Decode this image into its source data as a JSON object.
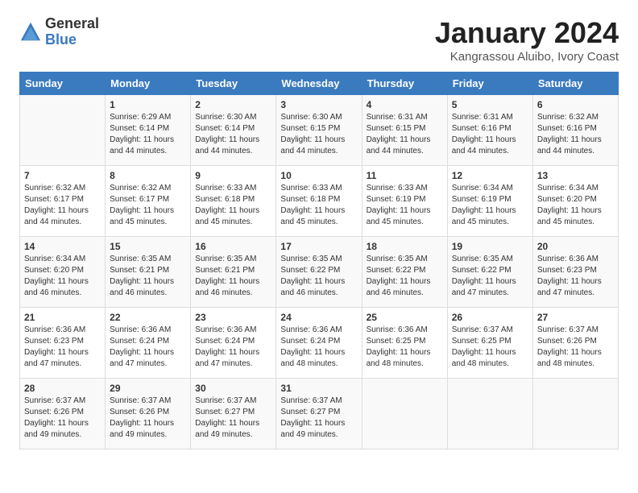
{
  "logo": {
    "general": "General",
    "blue": "Blue"
  },
  "title": {
    "month": "January 2024",
    "location": "Kangrassou Aluibo, Ivory Coast"
  },
  "days_of_week": [
    "Sunday",
    "Monday",
    "Tuesday",
    "Wednesday",
    "Thursday",
    "Friday",
    "Saturday"
  ],
  "weeks": [
    [
      {
        "day": "",
        "sunrise": "",
        "sunset": "",
        "daylight": ""
      },
      {
        "day": "1",
        "sunrise": "Sunrise: 6:29 AM",
        "sunset": "Sunset: 6:14 PM",
        "daylight": "Daylight: 11 hours and 44 minutes."
      },
      {
        "day": "2",
        "sunrise": "Sunrise: 6:30 AM",
        "sunset": "Sunset: 6:14 PM",
        "daylight": "Daylight: 11 hours and 44 minutes."
      },
      {
        "day": "3",
        "sunrise": "Sunrise: 6:30 AM",
        "sunset": "Sunset: 6:15 PM",
        "daylight": "Daylight: 11 hours and 44 minutes."
      },
      {
        "day": "4",
        "sunrise": "Sunrise: 6:31 AM",
        "sunset": "Sunset: 6:15 PM",
        "daylight": "Daylight: 11 hours and 44 minutes."
      },
      {
        "day": "5",
        "sunrise": "Sunrise: 6:31 AM",
        "sunset": "Sunset: 6:16 PM",
        "daylight": "Daylight: 11 hours and 44 minutes."
      },
      {
        "day": "6",
        "sunrise": "Sunrise: 6:32 AM",
        "sunset": "Sunset: 6:16 PM",
        "daylight": "Daylight: 11 hours and 44 minutes."
      }
    ],
    [
      {
        "day": "7",
        "sunrise": "Sunrise: 6:32 AM",
        "sunset": "Sunset: 6:17 PM",
        "daylight": "Daylight: 11 hours and 44 minutes."
      },
      {
        "day": "8",
        "sunrise": "Sunrise: 6:32 AM",
        "sunset": "Sunset: 6:17 PM",
        "daylight": "Daylight: 11 hours and 45 minutes."
      },
      {
        "day": "9",
        "sunrise": "Sunrise: 6:33 AM",
        "sunset": "Sunset: 6:18 PM",
        "daylight": "Daylight: 11 hours and 45 minutes."
      },
      {
        "day": "10",
        "sunrise": "Sunrise: 6:33 AM",
        "sunset": "Sunset: 6:18 PM",
        "daylight": "Daylight: 11 hours and 45 minutes."
      },
      {
        "day": "11",
        "sunrise": "Sunrise: 6:33 AM",
        "sunset": "Sunset: 6:19 PM",
        "daylight": "Daylight: 11 hours and 45 minutes."
      },
      {
        "day": "12",
        "sunrise": "Sunrise: 6:34 AM",
        "sunset": "Sunset: 6:19 PM",
        "daylight": "Daylight: 11 hours and 45 minutes."
      },
      {
        "day": "13",
        "sunrise": "Sunrise: 6:34 AM",
        "sunset": "Sunset: 6:20 PM",
        "daylight": "Daylight: 11 hours and 45 minutes."
      }
    ],
    [
      {
        "day": "14",
        "sunrise": "Sunrise: 6:34 AM",
        "sunset": "Sunset: 6:20 PM",
        "daylight": "Daylight: 11 hours and 46 minutes."
      },
      {
        "day": "15",
        "sunrise": "Sunrise: 6:35 AM",
        "sunset": "Sunset: 6:21 PM",
        "daylight": "Daylight: 11 hours and 46 minutes."
      },
      {
        "day": "16",
        "sunrise": "Sunrise: 6:35 AM",
        "sunset": "Sunset: 6:21 PM",
        "daylight": "Daylight: 11 hours and 46 minutes."
      },
      {
        "day": "17",
        "sunrise": "Sunrise: 6:35 AM",
        "sunset": "Sunset: 6:22 PM",
        "daylight": "Daylight: 11 hours and 46 minutes."
      },
      {
        "day": "18",
        "sunrise": "Sunrise: 6:35 AM",
        "sunset": "Sunset: 6:22 PM",
        "daylight": "Daylight: 11 hours and 46 minutes."
      },
      {
        "day": "19",
        "sunrise": "Sunrise: 6:35 AM",
        "sunset": "Sunset: 6:22 PM",
        "daylight": "Daylight: 11 hours and 47 minutes."
      },
      {
        "day": "20",
        "sunrise": "Sunrise: 6:36 AM",
        "sunset": "Sunset: 6:23 PM",
        "daylight": "Daylight: 11 hours and 47 minutes."
      }
    ],
    [
      {
        "day": "21",
        "sunrise": "Sunrise: 6:36 AM",
        "sunset": "Sunset: 6:23 PM",
        "daylight": "Daylight: 11 hours and 47 minutes."
      },
      {
        "day": "22",
        "sunrise": "Sunrise: 6:36 AM",
        "sunset": "Sunset: 6:24 PM",
        "daylight": "Daylight: 11 hours and 47 minutes."
      },
      {
        "day": "23",
        "sunrise": "Sunrise: 6:36 AM",
        "sunset": "Sunset: 6:24 PM",
        "daylight": "Daylight: 11 hours and 47 minutes."
      },
      {
        "day": "24",
        "sunrise": "Sunrise: 6:36 AM",
        "sunset": "Sunset: 6:24 PM",
        "daylight": "Daylight: 11 hours and 48 minutes."
      },
      {
        "day": "25",
        "sunrise": "Sunrise: 6:36 AM",
        "sunset": "Sunset: 6:25 PM",
        "daylight": "Daylight: 11 hours and 48 minutes."
      },
      {
        "day": "26",
        "sunrise": "Sunrise: 6:37 AM",
        "sunset": "Sunset: 6:25 PM",
        "daylight": "Daylight: 11 hours and 48 minutes."
      },
      {
        "day": "27",
        "sunrise": "Sunrise: 6:37 AM",
        "sunset": "Sunset: 6:26 PM",
        "daylight": "Daylight: 11 hours and 48 minutes."
      }
    ],
    [
      {
        "day": "28",
        "sunrise": "Sunrise: 6:37 AM",
        "sunset": "Sunset: 6:26 PM",
        "daylight": "Daylight: 11 hours and 49 minutes."
      },
      {
        "day": "29",
        "sunrise": "Sunrise: 6:37 AM",
        "sunset": "Sunset: 6:26 PM",
        "daylight": "Daylight: 11 hours and 49 minutes."
      },
      {
        "day": "30",
        "sunrise": "Sunrise: 6:37 AM",
        "sunset": "Sunset: 6:27 PM",
        "daylight": "Daylight: 11 hours and 49 minutes."
      },
      {
        "day": "31",
        "sunrise": "Sunrise: 6:37 AM",
        "sunset": "Sunset: 6:27 PM",
        "daylight": "Daylight: 11 hours and 49 minutes."
      },
      {
        "day": "",
        "sunrise": "",
        "sunset": "",
        "daylight": ""
      },
      {
        "day": "",
        "sunrise": "",
        "sunset": "",
        "daylight": ""
      },
      {
        "day": "",
        "sunrise": "",
        "sunset": "",
        "daylight": ""
      }
    ]
  ]
}
